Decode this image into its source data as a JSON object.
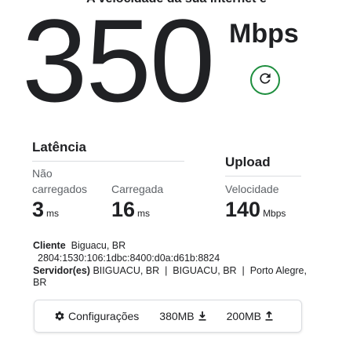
{
  "header": {
    "title": "A velocidade da sua internet é"
  },
  "speed": {
    "value": "350",
    "unit": "Mbps"
  },
  "icons": {
    "refresh": "refresh-icon",
    "gear": "gear-icon",
    "download": "download-icon",
    "upload": "upload-icon"
  },
  "colors": {
    "refresh_ring": "#1e8e3e",
    "text": "#202124",
    "muted": "#5f6368"
  },
  "latency": {
    "title": "Latência",
    "unloaded": {
      "label_line1": "Não",
      "label_line2": "carregados",
      "value": "3",
      "unit": "ms"
    },
    "loaded": {
      "label": "Carregada",
      "value": "16",
      "unit": "ms"
    }
  },
  "upload": {
    "title": "Upload",
    "speed_label": "Velocidade",
    "value": "140",
    "unit": "Mbps"
  },
  "info": {
    "client_label": "Cliente",
    "client_value": "Biguacu, BR",
    "client_ip": "2804:1530:106:1dbc:8400:d0a:d61b:8824",
    "server_label": "Servidor(es)",
    "server_value_line1": "BIIGUACU, BR  |  BIGUACU, BR  |  Porto Alegre,",
    "server_value_line2": "BR"
  },
  "config": {
    "settings_label": "Configurações",
    "download_amount": "380MB",
    "upload_amount": "200MB"
  }
}
